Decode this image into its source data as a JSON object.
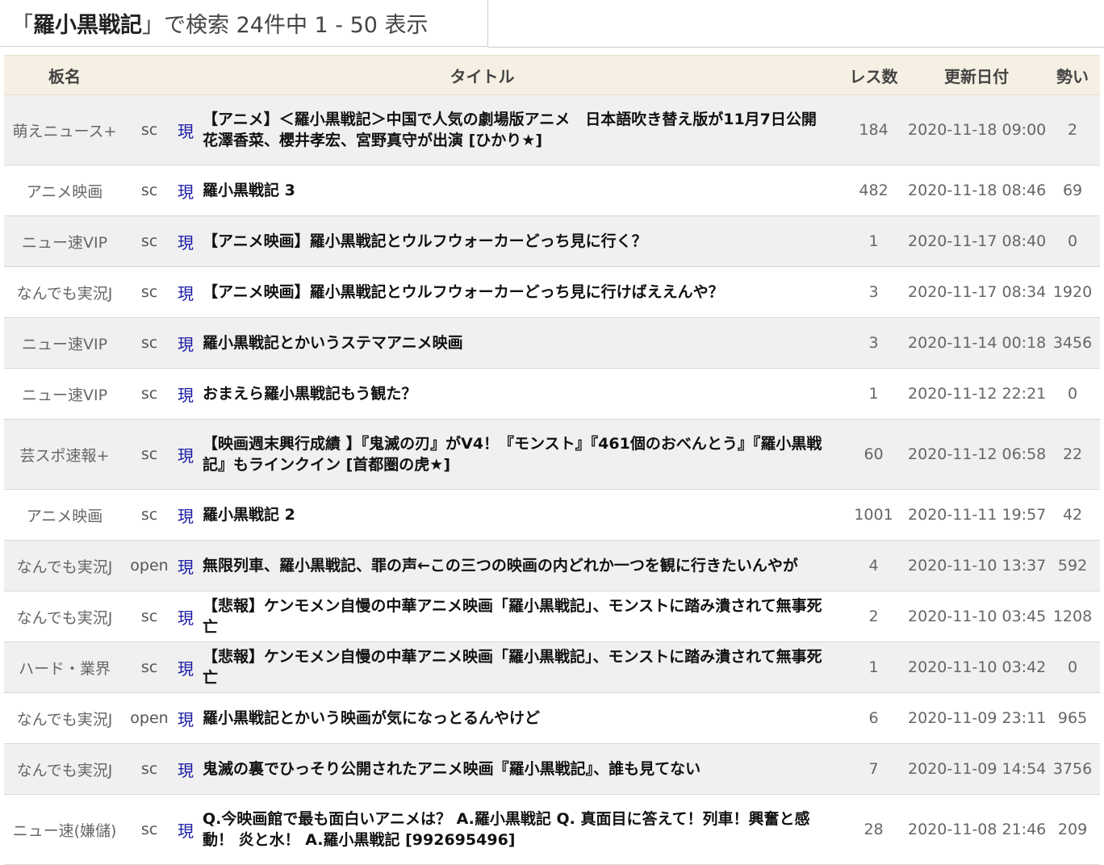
{
  "search": {
    "open_quote": "「",
    "query": "羅小黒戦記",
    "summary": "」で検索 24件中 1 - 50 表示"
  },
  "table": {
    "headers": {
      "board": "板名",
      "title": "タイトル",
      "res": "レス数",
      "updated": "更新日付",
      "momentum": "勢い"
    },
    "rows": [
      {
        "board": "萌えニュース+",
        "server": "sc",
        "now": "現",
        "title": "【アニメ】＜羅小黒戦記＞中国で人気の劇場版アニメ　日本語吹き替え版が11月7日公開　花澤香菜、櫻井孝宏、宮野真守が出演 [ひかり★]",
        "res": "184",
        "date": "2020-11-18 09:00",
        "momentum": "2"
      },
      {
        "board": "アニメ映画",
        "server": "sc",
        "now": "現",
        "title": "羅小黒戦記 3",
        "res": "482",
        "date": "2020-11-18 08:46",
        "momentum": "69"
      },
      {
        "board": "ニュー速VIP",
        "server": "sc",
        "now": "現",
        "title": "【アニメ映画】羅小黒戦記とウルフウォーカーどっち見に行く？",
        "res": "1",
        "date": "2020-11-17 08:40",
        "momentum": "0"
      },
      {
        "board": "なんでも実況J",
        "server": "sc",
        "now": "現",
        "title": "【アニメ映画】羅小黒戦記とウルフウォーカーどっち見に行けばええんや？",
        "res": "3",
        "date": "2020-11-17 08:34",
        "momentum": "1920"
      },
      {
        "board": "ニュー速VIP",
        "server": "sc",
        "now": "現",
        "title": "羅小黒戦記とかいうステマアニメ映画",
        "res": "3",
        "date": "2020-11-14 00:18",
        "momentum": "3456"
      },
      {
        "board": "ニュー速VIP",
        "server": "sc",
        "now": "現",
        "title": "おまえら羅小黒戦記もう観た？",
        "res": "1",
        "date": "2020-11-12 22:21",
        "momentum": "0"
      },
      {
        "board": "芸スポ速報+",
        "server": "sc",
        "now": "現",
        "title": "【映画週末興行成績 】『鬼滅の刃』がV4！『モンスト』『461個のおべんとう』『羅小黒戦記』もラインクイン [首都圏の虎★]",
        "res": "60",
        "date": "2020-11-12 06:58",
        "momentum": "22"
      },
      {
        "board": "アニメ映画",
        "server": "sc",
        "now": "現",
        "title": "羅小黒戦記 2",
        "res": "1001",
        "date": "2020-11-11 19:57",
        "momentum": "42"
      },
      {
        "board": "なんでも実況J",
        "server": "open",
        "now": "現",
        "title": "無限列車、羅小黒戦記、罪の声←この三つの映画の内どれか一つを観に行きたいんやが",
        "res": "4",
        "date": "2020-11-10 13:37",
        "momentum": "592"
      },
      {
        "board": "なんでも実況J",
        "server": "sc",
        "now": "現",
        "title": "【悲報】ケンモメン自慢の中華アニメ映画「羅小黒戦記」、モンストに踏み潰されて無事死亡",
        "res": "2",
        "date": "2020-11-10 03:45",
        "momentum": "1208"
      },
      {
        "board": "ハード・業界",
        "server": "sc",
        "now": "現",
        "title": "【悲報】ケンモメン自慢の中華アニメ映画「羅小黒戦記」、モンストに踏み潰されて無事死亡",
        "res": "1",
        "date": "2020-11-10 03:42",
        "momentum": "0"
      },
      {
        "board": "なんでも実況J",
        "server": "open",
        "now": "現",
        "title": "羅小黒戦記とかいう映画が気になっとるんやけど",
        "res": "6",
        "date": "2020-11-09 23:11",
        "momentum": "965"
      },
      {
        "board": "なんでも実況J",
        "server": "sc",
        "now": "現",
        "title": "鬼滅の裏でひっそり公開されたアニメ映画『羅小黒戦記』、誰も見てない",
        "res": "7",
        "date": "2020-11-09 14:54",
        "momentum": "3756"
      },
      {
        "board": "ニュー速(嫌儲)",
        "server": "sc",
        "now": "現",
        "title": "Q.今映画館で最も面白いアニメは？ A.羅小黒戦記 Q. 真面目に答えて！列車！興奮と感動！ 炎と水！ A.羅小黒戦記 [992695496]",
        "res": "28",
        "date": "2020-11-08 21:46",
        "momentum": "209"
      }
    ]
  }
}
